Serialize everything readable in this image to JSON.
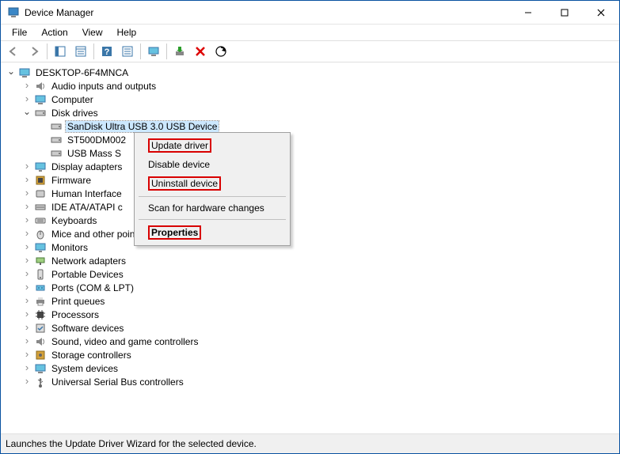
{
  "window": {
    "title": "Device Manager"
  },
  "menu": {
    "file": "File",
    "action": "Action",
    "view": "View",
    "help": "Help"
  },
  "toolbar": {
    "back": "back-icon",
    "forward": "forward-icon",
    "up": "show-hide-console-tree-icon",
    "properties_pane": "properties-icon",
    "help": "help-icon",
    "action_list": "action-list-icon",
    "monitor": "computer-icon",
    "install": "install-icon",
    "delete": "delete-icon",
    "scan": "scan-icon"
  },
  "tree": {
    "root": "DESKTOP-6F4MNCA",
    "audio": "Audio inputs and outputs",
    "computer": "Computer",
    "disk_drives": "Disk drives",
    "disk_children": {
      "sandisk": "SanDisk Ultra USB 3.0 USB Device",
      "st500": "ST500DM002",
      "usbmass": "USB Mass S"
    },
    "display_adapters": "Display adapters",
    "firmware": "Firmware",
    "hid": "Human Interface",
    "ide": "IDE ATA/ATAPI c",
    "keyboards": "Keyboards",
    "mice": "Mice and other pointing devices",
    "monitors": "Monitors",
    "network": "Network adapters",
    "portable": "Portable Devices",
    "ports": "Ports (COM & LPT)",
    "print_queues": "Print queues",
    "processors": "Processors",
    "software": "Software devices",
    "sound": "Sound, video and game controllers",
    "storage": "Storage controllers",
    "system": "System devices",
    "usb": "Universal Serial Bus controllers"
  },
  "context": {
    "update": "Update driver",
    "disable": "Disable device",
    "uninstall": "Uninstall device",
    "scan": "Scan for hardware changes",
    "properties": "Properties"
  },
  "status": "Launches the Update Driver Wizard for the selected device."
}
